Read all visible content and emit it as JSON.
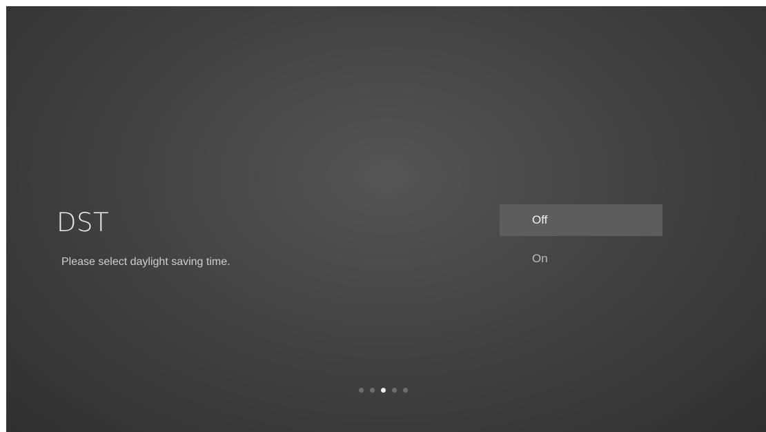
{
  "screen": {
    "title": "DST",
    "subtitle": "Please select daylight saving time."
  },
  "options": [
    {
      "label": "Off",
      "selected": true
    },
    {
      "label": "On",
      "selected": false
    }
  ],
  "pager": {
    "total": 5,
    "current": 3
  },
  "colors": {
    "background": "#474747",
    "highlight": "#5d5d5d",
    "text": "#e6e6e6"
  }
}
